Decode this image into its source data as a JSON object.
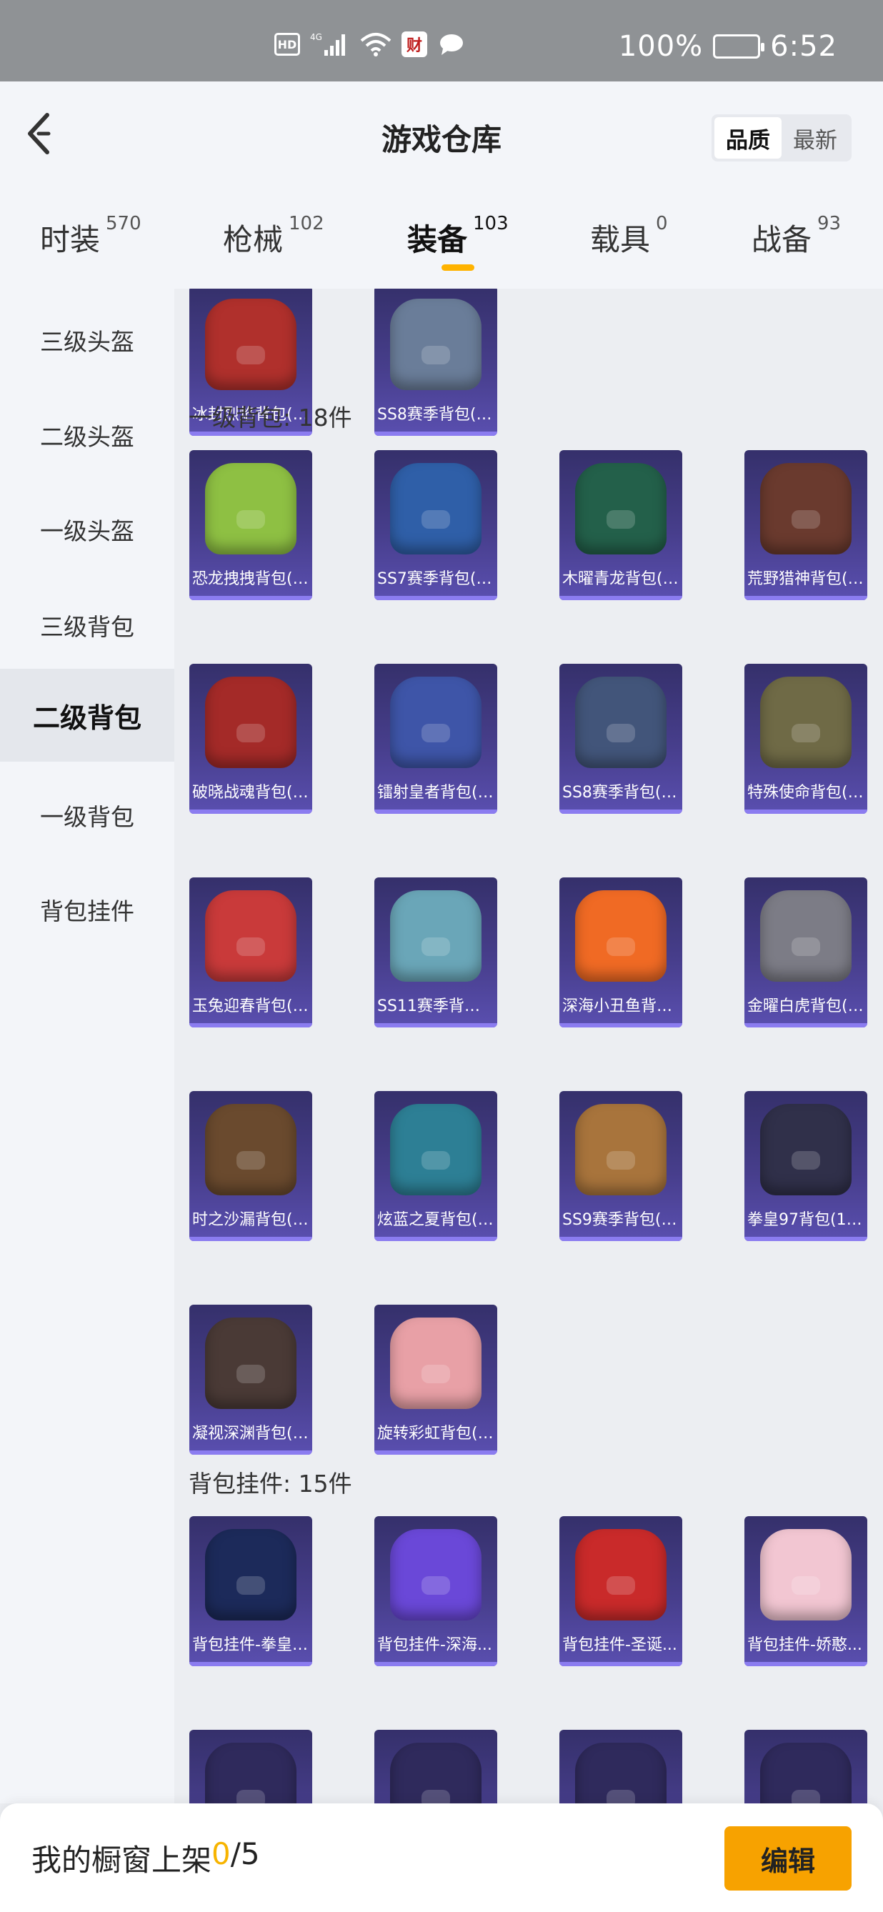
{
  "status_bar": {
    "hd": "HD",
    "net": "4G",
    "app_glyph": "财",
    "battery": "100%",
    "time": "6:52"
  },
  "header": {
    "title": "游戏仓库",
    "sort_options": [
      "品质",
      "最新"
    ]
  },
  "category_tabs": [
    {
      "label": "时装",
      "count": "570"
    },
    {
      "label": "枪械",
      "count": "102"
    },
    {
      "label": "装备",
      "count": "103"
    },
    {
      "label": "载具",
      "count": "0"
    },
    {
      "label": "战备",
      "count": "93"
    }
  ],
  "sidebar": [
    "三级头盔",
    "二级头盔",
    "一级头盔",
    "三级背包",
    "二级背包",
    "一级背包",
    "背包挂件"
  ],
  "sections": [
    {
      "title": "",
      "items": [
        "冰封烈焰背包(2...",
        "SS8赛季背包(2..."
      ]
    },
    {
      "title": "一级背包: 18件",
      "items": [
        "恐龙拽拽背包(1...",
        "SS7赛季背包(1...",
        "木曜青龙背包(1...",
        "荒野猎神背包(1...",
        "破晓战魂背包(1...",
        "镭射皇者背包(1...",
        "SS8赛季背包(1...",
        "特殊使命背包(1...",
        "玉兔迎春背包(1...",
        "SS11赛季背包(...",
        "深海小丑鱼背包...",
        "金曜白虎背包(1...",
        "时之沙漏背包(1...",
        "炫蓝之夏背包(1...",
        "SS9赛季背包(1...",
        "拳皇97背包(1级)",
        "凝视深渊背包(1...",
        "旋转彩虹背包(1..."
      ]
    },
    {
      "title": "背包挂件: 15件",
      "items": [
        "背包挂件-拳皇97",
        "背包挂件-深海...",
        "背包挂件-圣诞...",
        "背包挂件-娇憨...",
        "",
        "",
        "",
        ""
      ]
    }
  ],
  "item_colors": {
    "冰封烈焰背包(2...": "#b0302c",
    "SS8赛季背包(2...": "#6a7d99",
    "恐龙拽拽背包(1...": "#8ec043",
    "SS7赛季背包(1...": "#2f5fa8",
    "木曜青龙背包(1...": "#23604a",
    "荒野猎神背包(1...": "#6a3a2e",
    "破晓战魂背包(1...": "#a42a28",
    "镭射皇者背包(1...": "#3e55a8",
    "SS8赛季背包(1...": "#42557a",
    "特殊使命背包(1...": "#6f6a46",
    "玉兔迎春背包(1...": "#c93a3a",
    "SS11赛季背包(...": "#6aa6b8",
    "深海小丑鱼背包...": "#f06a24",
    "金曜白虎背包(1...": "#7c7c86",
    "时之沙漏背包(1...": "#6a4a2e",
    "炫蓝之夏背包(1...": "#2d7f95",
    "SS9赛季背包(1...": "#a8743c",
    "拳皇97背包(1级)": "#30304a",
    "凝视深渊背包(1...": "#4a3a36",
    "旋转彩虹背包(1...": "#e8a0a6",
    "背包挂件-拳皇97": "#1c2a5a",
    "背包挂件-深海...": "#6a48d8",
    "背包挂件-圣诞...": "#c92a2a",
    "背包挂件-娇憨...": "#f2c6d2"
  },
  "bottom_bar": {
    "label": "我的橱窗上架",
    "count": "0",
    "total": "/5",
    "edit": "编辑"
  },
  "colors": {
    "accent": "#f7b400",
    "card_bg": "#473e8c",
    "button": "#f7a200"
  }
}
